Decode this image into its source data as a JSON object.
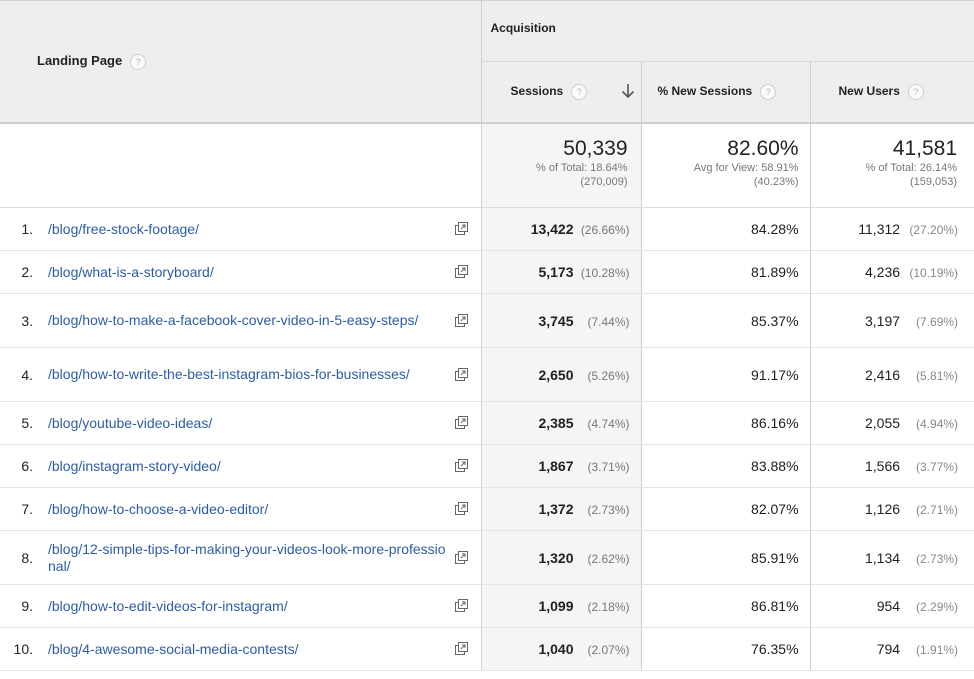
{
  "header": {
    "landing_page_label": "Landing Page",
    "acquisition_label": "Acquisition",
    "columns": {
      "sessions": "Sessions",
      "new_sessions": "% New Sessions",
      "new_users": "New Users"
    },
    "help_glyph": "?",
    "sort_icon": "arrow-down-icon"
  },
  "totals": {
    "sessions": {
      "value": "50,339",
      "line1": "% of Total: 18.64%",
      "line2": "(270,009)"
    },
    "new_sessions": {
      "value": "82.60%",
      "line1": "Avg for View: 58.91%",
      "line2": "(40.23%)"
    },
    "new_users": {
      "value": "41,581",
      "line1": "% of Total: 26.14%",
      "line2": "(159,053)"
    }
  },
  "rows": [
    {
      "index": "1.",
      "page": "/blog/free-stock-footage/",
      "sessions": "13,422",
      "sessions_pct": "(26.66%)",
      "new_sessions": "84.28%",
      "new_users": "11,312",
      "new_users_pct": "(27.20%)"
    },
    {
      "index": "2.",
      "page": "/blog/what-is-a-storyboard/",
      "sessions": "5,173",
      "sessions_pct": "(10.28%)",
      "new_sessions": "81.89%",
      "new_users": "4,236",
      "new_users_pct": "(10.19%)"
    },
    {
      "index": "3.",
      "page": "/blog/how-to-make-a-facebook-cover-video-in-5-easy-steps/",
      "sessions": "3,745",
      "sessions_pct": "(7.44%)",
      "new_sessions": "85.37%",
      "new_users": "3,197",
      "new_users_pct": "(7.69%)"
    },
    {
      "index": "4.",
      "page": "/blog/how-to-write-the-best-instagram-bios-for-businesses/",
      "sessions": "2,650",
      "sessions_pct": "(5.26%)",
      "new_sessions": "91.17%",
      "new_users": "2,416",
      "new_users_pct": "(5.81%)"
    },
    {
      "index": "5.",
      "page": "/blog/youtube-video-ideas/",
      "sessions": "2,385",
      "sessions_pct": "(4.74%)",
      "new_sessions": "86.16%",
      "new_users": "2,055",
      "new_users_pct": "(4.94%)"
    },
    {
      "index": "6.",
      "page": "/blog/instagram-story-video/",
      "sessions": "1,867",
      "sessions_pct": "(3.71%)",
      "new_sessions": "83.88%",
      "new_users": "1,566",
      "new_users_pct": "(3.77%)"
    },
    {
      "index": "7.",
      "page": "/blog/how-to-choose-a-video-editor/",
      "sessions": "1,372",
      "sessions_pct": "(2.73%)",
      "new_sessions": "82.07%",
      "new_users": "1,126",
      "new_users_pct": "(2.71%)"
    },
    {
      "index": "8.",
      "page": "/blog/12-simple-tips-for-making-your-videos-look-more-professional/",
      "sessions": "1,320",
      "sessions_pct": "(2.62%)",
      "new_sessions": "85.91%",
      "new_users": "1,134",
      "new_users_pct": "(2.73%)"
    },
    {
      "index": "9.",
      "page": "/blog/how-to-edit-videos-for-instagram/",
      "sessions": "1,099",
      "sessions_pct": "(2.18%)",
      "new_sessions": "86.81%",
      "new_users": "954",
      "new_users_pct": "(2.29%)"
    },
    {
      "index": "10.",
      "page": "/blog/4-awesome-social-media-contests/",
      "sessions": "1,040",
      "sessions_pct": "(2.07%)",
      "new_sessions": "76.35%",
      "new_users": "794",
      "new_users_pct": "(1.91%)"
    }
  ],
  "row_link_icon": "open-in-new-window-icon"
}
